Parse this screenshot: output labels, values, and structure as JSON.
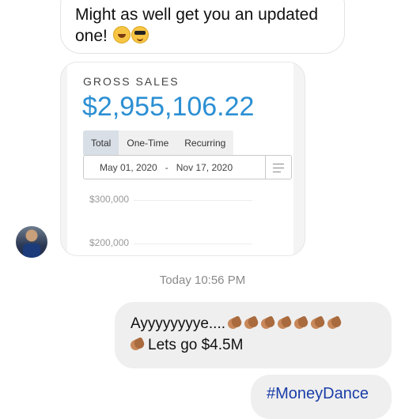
{
  "thread": {
    "incoming_text": {
      "line1": "Might as well get you an updated",
      "line2": "one!",
      "emojis": [
        "laughing-crying-icon",
        "sunglasses-icon"
      ]
    },
    "screenshot_card": {
      "label": "GROSS SALES",
      "value": "$2,955,106.22",
      "tabs": [
        "Total",
        "One-Time",
        "Recurring"
      ],
      "active_tab": "Total",
      "date_start": "May 01, 2020",
      "date_sep": "-",
      "date_end": "Nov 17, 2020",
      "y_labels": [
        "$300,000",
        "$200,000"
      ]
    },
    "timestamp": "Today 10:56 PM",
    "outgoing": [
      {
        "text_a": "Ayyyyyyyye....",
        "text_b": "Lets go $4.5M",
        "emoji": "clapping-hands-icon"
      },
      {
        "text": "#MoneyDance"
      }
    ]
  },
  "colors": {
    "accent_blue": "#2b8fd3",
    "hashtag_blue": "#1a3ea8",
    "outgoing_bg": "#efefef"
  }
}
